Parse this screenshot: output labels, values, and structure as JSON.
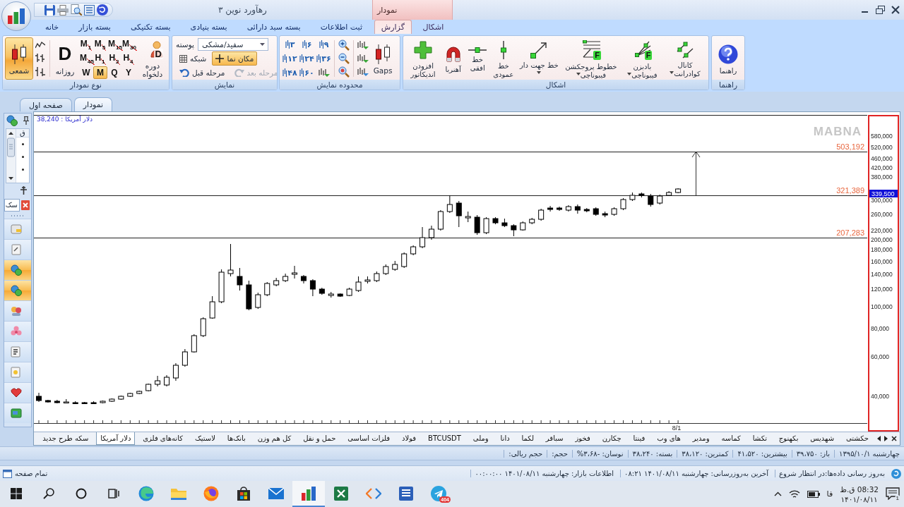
{
  "window": {
    "title": "رهآورد نوین ۳",
    "context_header": "نمودار"
  },
  "ribbon_tabs": [
    {
      "label": "اشکال",
      "selected": false,
      "contextual": true
    },
    {
      "label": "گزارش",
      "selected": true,
      "contextual": true
    },
    {
      "label": "ثبت اطلاعات",
      "selected": false,
      "contextual": false
    },
    {
      "label": "بسته سبد دارائی",
      "selected": false,
      "contextual": false
    },
    {
      "label": "بسته بنیادی",
      "selected": false,
      "contextual": false
    },
    {
      "label": "بسته تکنیکی",
      "selected": false,
      "contextual": false
    },
    {
      "label": "بسته بازار",
      "selected": false,
      "contextual": false
    },
    {
      "label": "خانه",
      "selected": false,
      "contextual": false
    }
  ],
  "chart_type_group": {
    "title": "نوع نمودار",
    "candle_button": {
      "label": "شمعی",
      "selected": true
    },
    "daily_button": {
      "letter": "D",
      "label": "روزانه"
    },
    "periods": [
      {
        "label": "M$_{30}$",
        "selected": false
      },
      {
        "label": "M$_{15}$",
        "selected": false
      },
      {
        "label": "M$_{5}$",
        "selected": false
      },
      {
        "label": "M$_{1}$",
        "selected": false
      },
      {
        "label": "H$_{4}$",
        "selected": false
      },
      {
        "label": "H$_{2}$",
        "selected": false
      },
      {
        "label": "H$_{1}$",
        "selected": false
      },
      {
        "label": "M$_{45}$",
        "selected": false
      },
      {
        "label": "Y",
        "selected": false
      },
      {
        "label": "Q",
        "selected": false
      },
      {
        "label": "M",
        "selected": true
      },
      {
        "label": "W",
        "selected": false
      }
    ],
    "custom_period_button": {
      "letter": "D",
      "label": "دوره\nدلخواه"
    }
  },
  "view_group": {
    "title": "نمایش",
    "skin_label": "پوسته",
    "skin_value": "سفید/مشکی",
    "grid_button": {
      "label": "شبکه"
    },
    "cursor_button": {
      "label": "مکان نما",
      "selected": true
    },
    "undo_button": {
      "label": "مرحله قبل",
      "disabled": false
    },
    "redo_button": {
      "label": "مرحله بعد",
      "disabled": true
    }
  },
  "range_group": {
    "title": "محدوده نمایش",
    "ranges": [
      {
        "label": "۹"
      },
      {
        "label": "۶"
      },
      {
        "label": "۳"
      },
      {
        "label": "۳۶"
      },
      {
        "label": "۲۴"
      },
      {
        "label": "۱۲"
      },
      {
        "label": "۶۰"
      },
      {
        "label": "۴۸"
      }
    ],
    "gaps_button": {
      "label": "Gaps"
    }
  },
  "shapes_group": {
    "title": "اشکال",
    "tools": [
      {
        "label": "کانال\nکوادرانت",
        "dropdown": true
      },
      {
        "label": "بادبزن\nفیبوناچی",
        "dropdown": true,
        "badge": "F"
      },
      {
        "label": "خطوط پروجکشن\nفیبوناچی",
        "dropdown": true,
        "badge": "F"
      },
      {
        "label": "خط جهت دار",
        "dropdown": true
      },
      {
        "label": "خط\nعمودی",
        "dropdown": false
      },
      {
        "label": "خط\nافقی",
        "dropdown": false
      },
      {
        "label": "آهنربا",
        "dropdown": false
      },
      {
        "label": "افزودن\nاندیکاتور",
        "dropdown": false
      }
    ]
  },
  "help_group": {
    "title": "راهنما",
    "button_label": "راهنما"
  },
  "doc_tabs": [
    {
      "label": "نمودار",
      "selected": true
    },
    {
      "label": "صفحه اول",
      "selected": false
    }
  ],
  "side_panel": {
    "list_header": "ق",
    "search_value": "سک",
    "nav_items": [
      {
        "selected": false
      },
      {
        "selected": false
      },
      {
        "selected": true
      },
      {
        "selected": true
      },
      {
        "selected": false
      },
      {
        "selected": false
      },
      {
        "selected": false
      },
      {
        "selected": false
      },
      {
        "selected": false
      },
      {
        "selected": false
      }
    ]
  },
  "chart": {
    "header": "دلار آمریکا : 38,240",
    "watermark": "MABNA",
    "levels": [
      {
        "label": "503,192"
      },
      {
        "label": "321,389"
      },
      {
        "label": "207,283"
      }
    ],
    "y_axis_labels": [
      "580,000",
      "520,000",
      "460,000",
      "420,000",
      "380,000",
      "300,000",
      "260,000",
      "220,000",
      "200,000",
      "180,000",
      "160,000",
      "140,000",
      "120,000",
      "100,000",
      "80,000",
      "60,000",
      "40,000"
    ],
    "price_label": "339,500",
    "x_axis_labels": [
      "8/1"
    ]
  },
  "symbol_tabs": [
    {
      "label": "حکشتی",
      "selected": false
    },
    {
      "label": "شهدیس",
      "selected": false
    },
    {
      "label": "بکهنوج",
      "selected": false
    },
    {
      "label": "تکشا",
      "selected": false
    },
    {
      "label": "کماسه",
      "selected": false
    },
    {
      "label": "ومدیر",
      "selected": false
    },
    {
      "label": "های وب",
      "selected": false
    },
    {
      "label": "فینتا",
      "selected": false
    },
    {
      "label": "چکارن",
      "selected": false
    },
    {
      "label": "فخوز",
      "selected": false
    },
    {
      "label": "سباقر",
      "selected": false
    },
    {
      "label": "لکما",
      "selected": false
    },
    {
      "label": "دانا",
      "selected": false
    },
    {
      "label": "وملی",
      "selected": false
    },
    {
      "label": "BTCUSDT",
      "selected": false
    },
    {
      "label": "فولاد",
      "selected": false
    },
    {
      "label": "فلزات اساسی",
      "selected": false
    },
    {
      "label": "حمل و نقل",
      "selected": false
    },
    {
      "label": "کل هم وزن",
      "selected": false
    },
    {
      "label": "بانک‌ها",
      "selected": false
    },
    {
      "label": "لاستیک",
      "selected": false
    },
    {
      "label": "کانه‌های فلزی",
      "selected": false
    },
    {
      "label": "دلار آمریکا",
      "selected": true
    },
    {
      "label": "سکه طرح جدید",
      "selected": false
    }
  ],
  "status_bar": [
    "چهارشنبه ۱۳۹۵/۱۰/۱",
    "باز: ۳۹،۷۵۰",
    "بیشترین: ۴۱،۵۲۰",
    "کمترین: ۳۸،۱۲۰",
    "بسته: ۳۸،۲۴۰",
    "نوسان: -۳،۶۸%",
    "حجم:",
    "حجم ریالی:"
  ],
  "info_bar": {
    "left_label": "تمام صفحه",
    "items": [
      "به‌روز رسانی داده‌ها:در انتظار شروع",
      "آخرین به‌روزرسانی: چهارشنبه ۱۴۰۱/۰۸/۱۱ ۰۸:۲۱",
      "اطلاعات بازار: چهارشنبه ۱۴۰۱/۰۸/۱۱ ۰۰:۰۰:۰۰"
    ]
  },
  "taskbar": {
    "buttons": [
      {
        "selected": false
      },
      {
        "selected": false
      },
      {
        "selected": false
      },
      {
        "selected": false
      },
      {
        "selected": false
      },
      {
        "selected": false
      },
      {
        "selected": false
      },
      {
        "selected": false
      },
      {
        "selected": false
      },
      {
        "selected": true
      },
      {
        "selected": false
      },
      {
        "selected": false
      },
      {
        "selected": false
      },
      {
        "selected": false,
        "badge": "404"
      }
    ],
    "language": "فا",
    "time": "08:32 ق.ظ",
    "date": "۱۴۰۱/۰۸/۱۱",
    "notification_count": "1"
  }
}
